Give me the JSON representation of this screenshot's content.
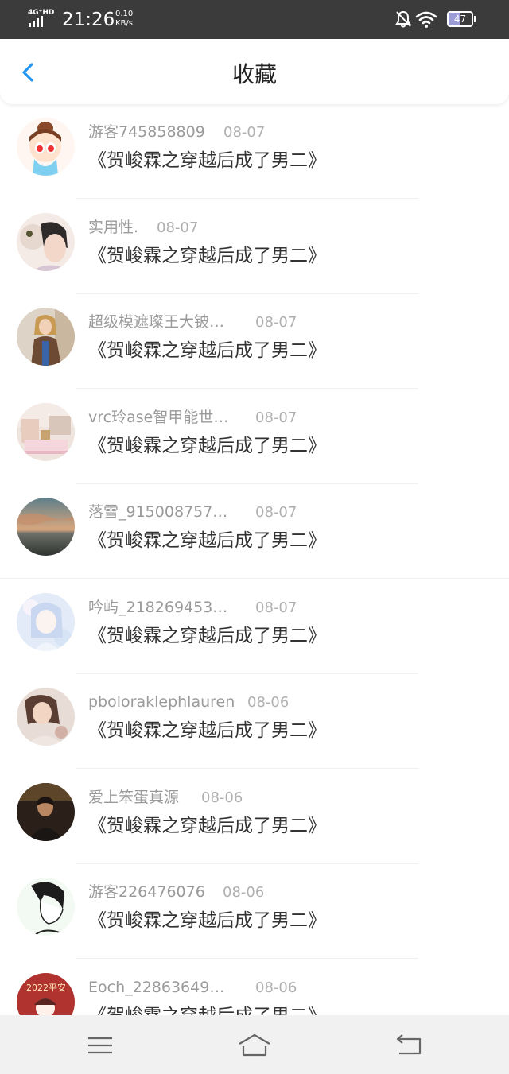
{
  "status_bar": {
    "network": "4G⁺HD",
    "time": "21:26",
    "speed_value": "0.10",
    "speed_unit": "KB/s",
    "battery_level": "47",
    "icons": [
      "signal-icon",
      "mute-bell-icon",
      "wifi-icon",
      "battery-icon"
    ]
  },
  "header": {
    "title": "收藏",
    "back_icon": "chevron-left-icon",
    "accent_color": "#2196f3"
  },
  "list": {
    "items": [
      {
        "username": "游客745858809",
        "date": "08-07",
        "title": "《贺峻霖之穿越后成了男二》"
      },
      {
        "username": "实用性.",
        "date": "08-07",
        "title": "《贺峻霖之穿越后成了男二》"
      },
      {
        "username": "超级模遮璨王大铍…",
        "date": "08-07",
        "title": "《贺峻霖之穿越后成了男二》"
      },
      {
        "username": "vrc玲ase智甲能世…",
        "date": "08-07",
        "title": "《贺峻霖之穿越后成了男二》"
      },
      {
        "username": "落雪_915008757…",
        "date": "08-07",
        "title": "《贺峻霖之穿越后成了男二》"
      },
      {
        "username": "吟屿_218269453…",
        "date": "08-07",
        "title": "《贺峻霖之穿越后成了男二》"
      },
      {
        "username": "pboloraklephlauren",
        "date": "08-06",
        "title": "《贺峻霖之穿越后成了男二》"
      },
      {
        "username": "爱上笨蛋真源",
        "date": "08-06",
        "title": "《贺峻霖之穿越后成了男二》"
      },
      {
        "username": "游客226476076",
        "date": "08-06",
        "title": "《贺峻霖之穿越后成了男二》"
      },
      {
        "username": "Eoch_22863649…",
        "date": "08-06",
        "title": "《贺峻霖之穿越后成了男二》",
        "avatar_text": "2022平安"
      }
    ]
  },
  "bottom_nav": {
    "icons": [
      "menu-icon",
      "home-icon",
      "back-icon"
    ]
  }
}
